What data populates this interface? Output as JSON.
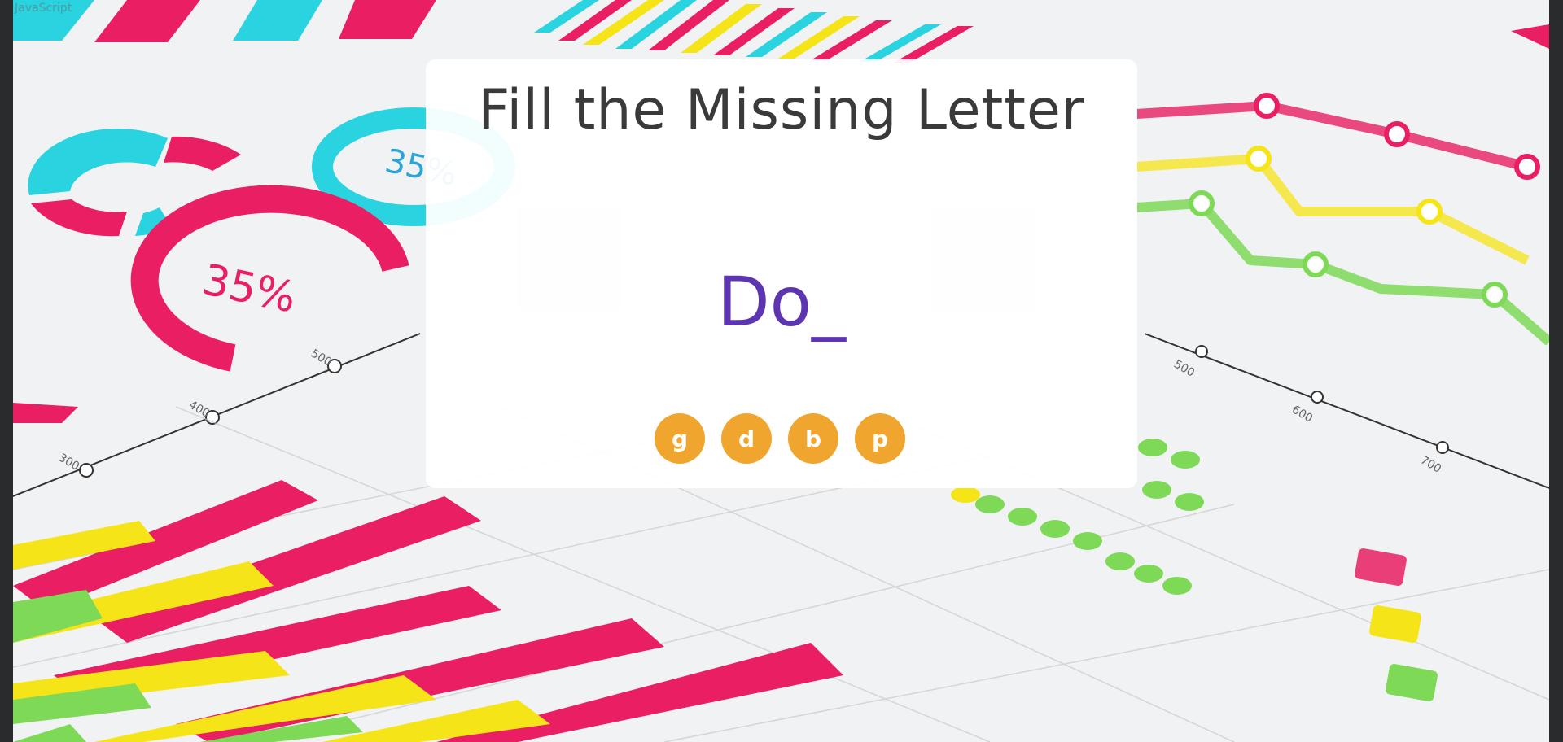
{
  "tab": {
    "label": "JavaScript"
  },
  "game": {
    "title": "Fill the Missing Letter",
    "word": "Do_",
    "options": [
      "g",
      "d",
      "b",
      "p"
    ]
  },
  "colors": {
    "title": "#3a3a3a",
    "word": "#5e35b1",
    "option_button": "#efa52e",
    "background_pink": "#e91e63",
    "background_yellow": "#f5e418",
    "background_green": "#7ed957",
    "background_cyan": "#29d3e0"
  },
  "background": {
    "name": "infographic-charts-backdrop",
    "gauge_labels": [
      "35%",
      "35%"
    ],
    "axis_ticks": [
      "300",
      "400",
      "500",
      "500",
      "600",
      "700"
    ]
  }
}
